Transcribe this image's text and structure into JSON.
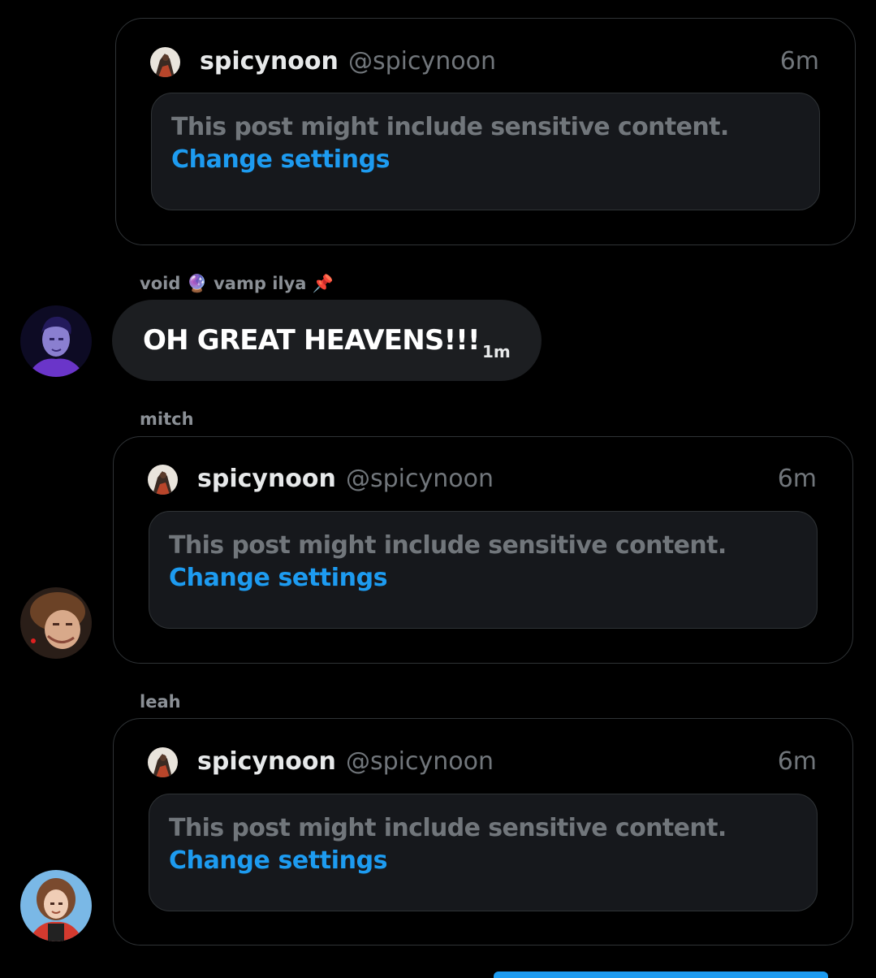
{
  "messages": [
    {
      "type": "shared_post",
      "post": {
        "author_name": "spicynoon",
        "author_handle": "@spicynoon",
        "time": "6m",
        "sensitive_text": "This post might include sensitive content.",
        "action_label": "Change settings"
      }
    },
    {
      "type": "text",
      "sender": "void 🔮 vamp ilya 📌",
      "text": "OH GREAT HEAVENS!!!",
      "time": "1m"
    },
    {
      "type": "shared_post",
      "sender": "mitch",
      "post": {
        "author_name": "spicynoon",
        "author_handle": "@spicynoon",
        "time": "6m",
        "sensitive_text": "This post might include sensitive content.",
        "action_label": "Change settings"
      }
    },
    {
      "type": "shared_post",
      "sender": "leah",
      "post": {
        "author_name": "spicynoon",
        "author_handle": "@spicynoon",
        "time": "6m",
        "sensitive_text": "This post might include sensitive content.",
        "action_label": "Change settings"
      }
    }
  ],
  "colors": {
    "background": "#000000",
    "card_border": "#2f3336",
    "sensitive_bg": "#16181c",
    "muted_text": "#71767b",
    "link": "#1d9bf0",
    "bubble_bg": "#1c1e21"
  }
}
